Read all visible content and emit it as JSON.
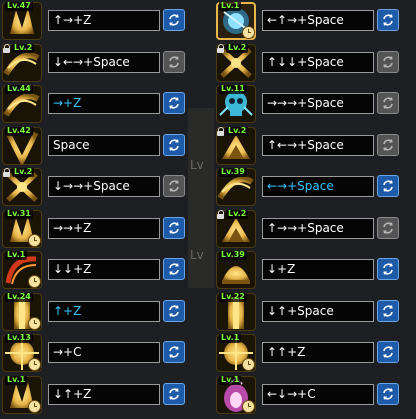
{
  "left_column": [
    {
      "level": "Lv.47",
      "locked": false,
      "clock": false,
      "icon": "golden-beast-claw-skill-icon",
      "keys": "↑→+Z",
      "highlight": false,
      "swap_active": true
    },
    {
      "level": "Lv.2",
      "locked": true,
      "clock": false,
      "icon": "golden-crescent-slash-skill-icon",
      "keys": "↓←→+Space",
      "highlight": false,
      "swap_active": false
    },
    {
      "level": "Lv.44",
      "locked": false,
      "clock": false,
      "icon": "golden-dash-skill-icon",
      "keys": "→+Z",
      "highlight": true,
      "swap_active": true
    },
    {
      "level": "Lv.42",
      "locked": false,
      "clock": false,
      "icon": "golden-v-slash-skill-icon",
      "keys": "Space",
      "highlight": false,
      "swap_active": true
    },
    {
      "level": "Lv.2",
      "locked": true,
      "clock": false,
      "icon": "golden-cross-strike-skill-icon",
      "keys": "↓→→+Space",
      "highlight": false,
      "swap_active": false
    },
    {
      "level": "Lv.31",
      "locked": false,
      "clock": true,
      "icon": "golden-claw-wave-skill-icon",
      "keys": "→→+Z",
      "highlight": false,
      "swap_active": true
    },
    {
      "level": "Lv.1",
      "locked": false,
      "clock": true,
      "icon": "crimson-arc-skill-icon",
      "keys": "↓↓+Z",
      "highlight": false,
      "swap_active": true
    },
    {
      "level": "Lv.24",
      "locked": false,
      "clock": true,
      "icon": "golden-pillar-skill-icon",
      "keys": "↑+Z",
      "highlight": true,
      "swap_active": true
    },
    {
      "level": "Lv.13",
      "locked": false,
      "clock": true,
      "icon": "golden-burst-skill-icon",
      "keys": "→+C",
      "highlight": false,
      "swap_active": true
    },
    {
      "level": "Lv.1",
      "locked": false,
      "clock": true,
      "icon": "golden-uppercut-skill-icon",
      "keys": "↓↑+Z",
      "highlight": false,
      "swap_active": true
    }
  ],
  "right_column": [
    {
      "level": "Lv.1",
      "locked": false,
      "clock": true,
      "icon": "blue-orb-skill-icon",
      "keys": "←↑→+Space",
      "highlight": false,
      "swap_active": true,
      "selected": true
    },
    {
      "level": "Lv.2",
      "locked": true,
      "clock": false,
      "icon": "golden-x-slash-skill-icon",
      "keys": "↑↓↓+Space",
      "highlight": false,
      "swap_active": false
    },
    {
      "level": "Lv.11",
      "locked": false,
      "clock": false,
      "icon": "cyan-skull-skill-icon",
      "keys": "→→→+Space",
      "highlight": false,
      "swap_active": false
    },
    {
      "level": "Lv.2",
      "locked": true,
      "clock": false,
      "icon": "golden-pyramid-skill-icon",
      "keys": "↑←→+Space",
      "highlight": false,
      "swap_active": false
    },
    {
      "level": "Lv.39",
      "locked": false,
      "clock": false,
      "icon": "golden-wind-skill-icon",
      "keys": "←→+Space",
      "highlight": true,
      "swap_active": true
    },
    {
      "level": "Lv.2",
      "locked": true,
      "clock": false,
      "icon": "golden-crown-skill-icon",
      "keys": "↑→→+Space",
      "highlight": false,
      "swap_active": false
    },
    {
      "level": "Lv.39",
      "locked": false,
      "clock": false,
      "icon": "golden-dome-skill-icon",
      "keys": "↓+Z",
      "highlight": false,
      "swap_active": true
    },
    {
      "level": "Lv.22",
      "locked": false,
      "clock": false,
      "icon": "golden-beam-skill-icon",
      "keys": "↓↑+Space",
      "highlight": false,
      "swap_active": true
    },
    {
      "level": "Lv.1",
      "locked": false,
      "clock": true,
      "icon": "golden-orb-burst-skill-icon",
      "keys": "↑↑+Z",
      "highlight": false,
      "swap_active": true
    },
    {
      "level": "Lv.1",
      "locked": false,
      "clock": true,
      "icon": "pink-flame-skill-icon",
      "keys": "←↓→+C",
      "highlight": false,
      "swap_active": true
    }
  ],
  "background_panel": {
    "label_top": "Lv",
    "label_bottom": "Lv"
  },
  "colors": {
    "level_text": "#7bff3a",
    "key_highlight": "#36c6ff",
    "swap_active": "#1d5aa8",
    "swap_inactive": "#545454",
    "icon_gold": "#e8b64a"
  }
}
